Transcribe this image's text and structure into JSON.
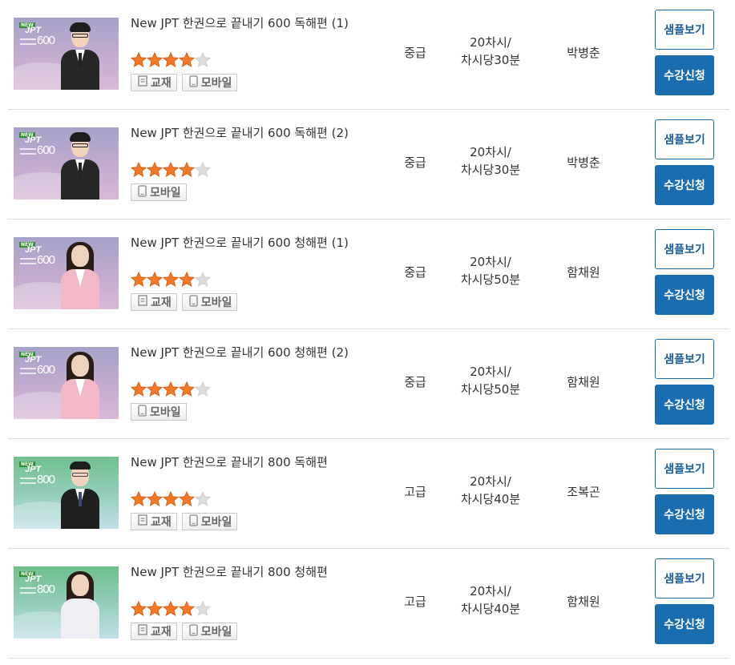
{
  "colors": {
    "accent": "#1a6eb0",
    "star_filled": "#f07a2a",
    "star_empty": "#dddddd",
    "divider": "#dddddd"
  },
  "courses": [
    {
      "title": "New JPT 한권으로 끝내기 600 독해편 (1)",
      "rating": 4,
      "tags": [
        {
          "icon": "book-icon",
          "label": "교재"
        },
        {
          "icon": "mobile-icon",
          "label": "모바일"
        }
      ],
      "level": "중급",
      "session_line1": "20차시/",
      "session_line2": "차시당30분",
      "teacher": "박병춘",
      "sample_label": "샘플보기",
      "enroll_label": "수강신청",
      "thumb": {
        "badge": "NEW",
        "brand": "JPT",
        "score": "600",
        "theme": "purple",
        "person": "male-glasses"
      }
    },
    {
      "title": "New JPT 한권으로 끝내기 600 독해편 (2)",
      "rating": 4,
      "tags": [
        {
          "icon": "mobile-icon",
          "label": "모바일"
        }
      ],
      "level": "중급",
      "session_line1": "20차시/",
      "session_line2": "차시당30분",
      "teacher": "박병춘",
      "sample_label": "샘플보기",
      "enroll_label": "수강신청",
      "thumb": {
        "badge": "NEW",
        "brand": "JPT",
        "score": "600",
        "theme": "purple",
        "person": "male-glasses"
      }
    },
    {
      "title": "New JPT 한권으로 끝내기 600 청해편 (1)",
      "rating": 4,
      "tags": [
        {
          "icon": "book-icon",
          "label": "교재"
        },
        {
          "icon": "mobile-icon",
          "label": "모바일"
        }
      ],
      "level": "중급",
      "session_line1": "20차시/",
      "session_line2": "차시당50분",
      "teacher": "함채원",
      "sample_label": "샘플보기",
      "enroll_label": "수강신청",
      "thumb": {
        "badge": "NEW",
        "brand": "JPT",
        "score": "600",
        "theme": "purple",
        "person": "female-pink"
      }
    },
    {
      "title": "New JPT 한권으로 끝내기 600 청해편 (2)",
      "rating": 4,
      "tags": [
        {
          "icon": "mobile-icon",
          "label": "모바일"
        }
      ],
      "level": "중급",
      "session_line1": "20차시/",
      "session_line2": "차시당50분",
      "teacher": "함채원",
      "sample_label": "샘플보기",
      "enroll_label": "수강신청",
      "thumb": {
        "badge": "NEW",
        "brand": "JPT",
        "score": "600",
        "theme": "purple",
        "person": "female-pink"
      }
    },
    {
      "title": "New JPT 한권으로 끝내기 800 독해편",
      "rating": 4,
      "tags": [
        {
          "icon": "book-icon",
          "label": "교재"
        },
        {
          "icon": "mobile-icon",
          "label": "모바일"
        }
      ],
      "level": "고급",
      "session_line1": "20차시/",
      "session_line2": "차시당40분",
      "teacher": "조복곤",
      "sample_label": "샘플보기",
      "enroll_label": "수강신청",
      "thumb": {
        "badge": "NEW",
        "brand": "JPT",
        "score": "800",
        "theme": "green",
        "person": "male-suit"
      }
    },
    {
      "title": "New JPT 한권으로 끝내기 800 청해편",
      "rating": 4,
      "tags": [
        {
          "icon": "book-icon",
          "label": "교재"
        },
        {
          "icon": "mobile-icon",
          "label": "모바일"
        }
      ],
      "level": "고급",
      "session_line1": "20차시/",
      "session_line2": "차시당40분",
      "teacher": "함채원",
      "sample_label": "샘플보기",
      "enroll_label": "수강신청",
      "thumb": {
        "badge": "NEW",
        "brand": "JPT",
        "score": "800",
        "theme": "green",
        "person": "female-white"
      }
    }
  ]
}
